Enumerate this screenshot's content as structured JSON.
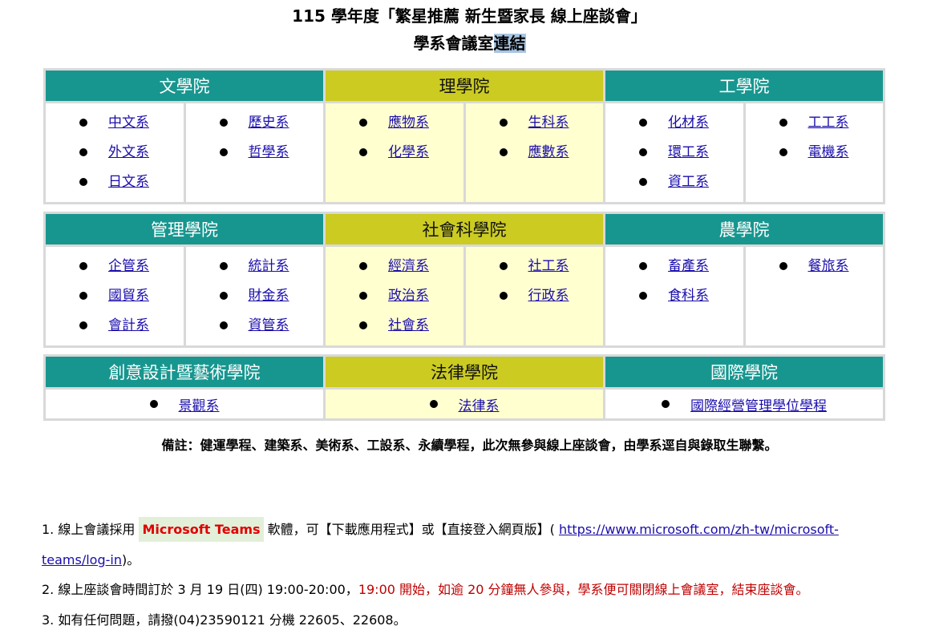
{
  "header": {
    "title_line1": "115 學年度「繁星推薦  新生暨家長  線上座談會」",
    "title_line2_a": "學系會議室",
    "title_line2_b": "連結"
  },
  "table1": {
    "colleges": [
      {
        "name": "文學院",
        "col1": [
          "中文系",
          "外文系",
          "日文系"
        ],
        "col2": [
          "歷史系",
          "哲學系"
        ]
      },
      {
        "name": "理學院",
        "col1": [
          "應物系",
          "化學系"
        ],
        "col2": [
          "生科系",
          "應數系"
        ]
      },
      {
        "name": "工學院",
        "col1": [
          "化材系",
          "環工系",
          "資工系"
        ],
        "col2": [
          "工工系",
          "電機系"
        ]
      }
    ]
  },
  "table2": {
    "colleges": [
      {
        "name": "管理學院",
        "col1": [
          "企管系",
          "國貿系",
          "會計系"
        ],
        "col2": [
          "統計系",
          "財金系",
          "資管系"
        ]
      },
      {
        "name": "社會科學院",
        "col1": [
          "經濟系",
          "政治系",
          "社會系"
        ],
        "col2": [
          "社工系",
          "行政系"
        ]
      },
      {
        "name": "農學院",
        "col1": [
          "畜產系",
          "食科系"
        ],
        "col2": [
          "餐旅系"
        ]
      }
    ]
  },
  "table3": {
    "colleges": [
      {
        "name": "創意設計暨藝術學院",
        "dept": "景觀系"
      },
      {
        "name": "法律學院",
        "dept": "法律系"
      },
      {
        "name": "國際學院",
        "dept": "國際經營管理學位學程"
      }
    ]
  },
  "note": "備註：健運學程、建築系、美術系、工設系、永續學程，此次無參與線上座談會，由學系逕自與錄取生聯繫。",
  "items": {
    "i1_pre": "1.  線上會議採用 ",
    "i1_teams": "Microsoft Teams",
    "i1_mid": "  軟體，可【下載應用程式】或【直接登入網頁版】( ",
    "i1_url_a": "https://www.microsoft.com/zh-tw/microsoft-",
    "i1_url_b": "teams/log-in",
    "i1_end": ")。",
    "i2_pre": "2.  線上座談會時間訂於 3 月 19 日(四) 19:00-20:00，",
    "i2_red": "19:00 開始，如逾 20 分鐘無人參與，學系便可關閉線上會議室，結束座談會。",
    "i3": "3.  如有任何問題，請撥(04)23590121 分機 22605、22608。"
  },
  "colors": {
    "teal": "#17968f",
    "olive": "#cbcb22",
    "light_yellow": "#ffffd0",
    "red": "#c00000"
  }
}
